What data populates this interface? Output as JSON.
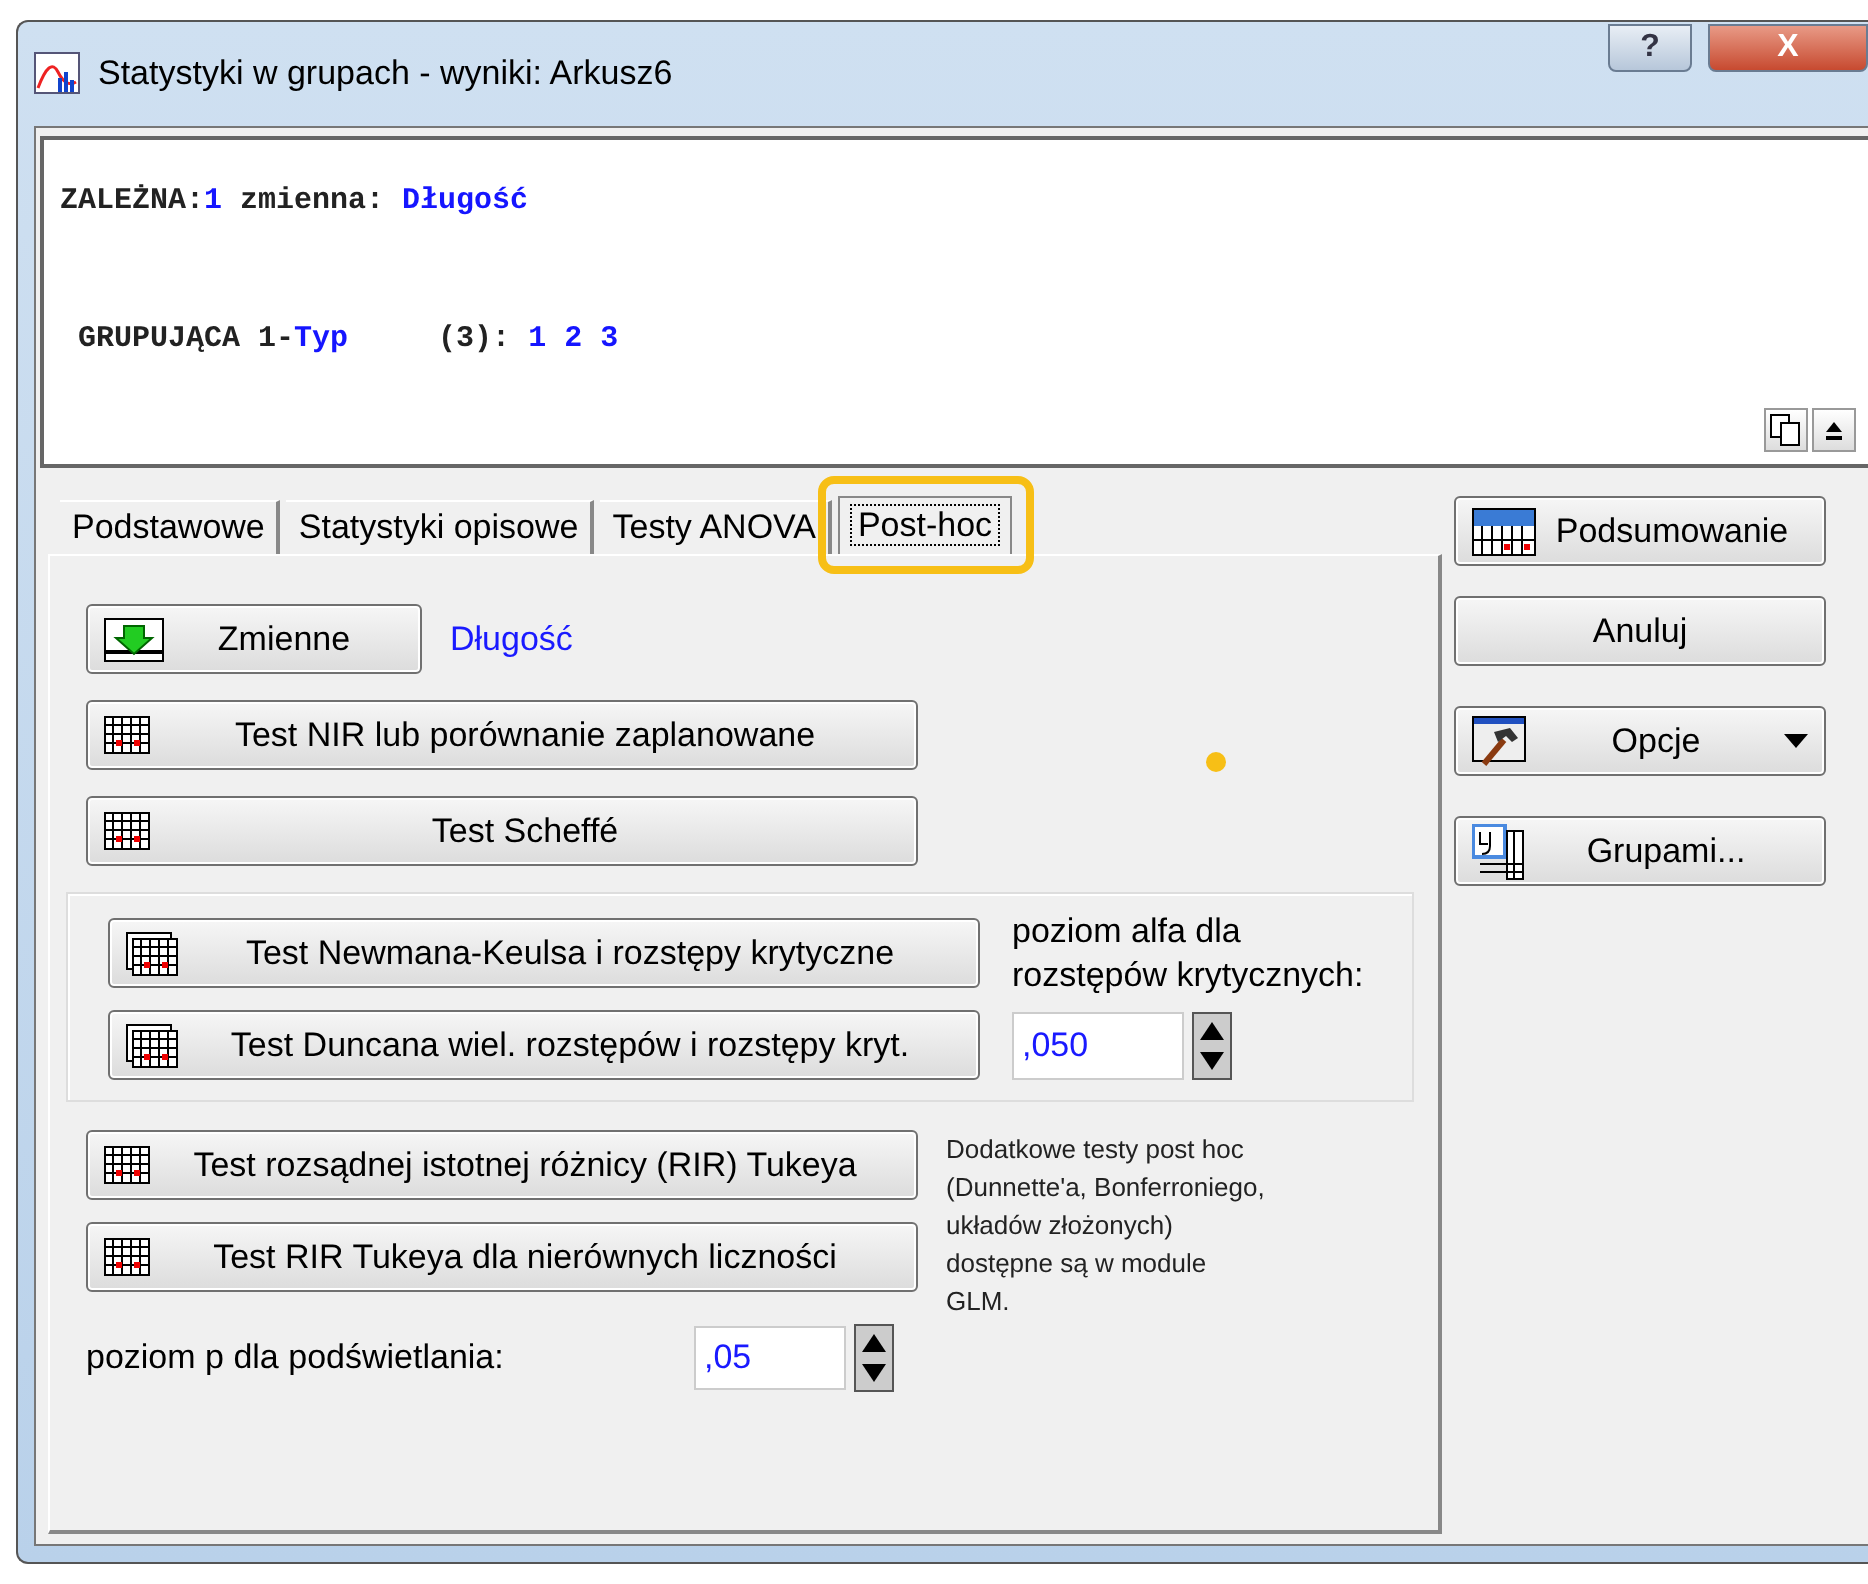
{
  "window": {
    "title": "Statystyki w grupach - wyniki: Arkusz6",
    "buttons": [
      {
        "kind": "help",
        "label": "?"
      },
      {
        "kind": "close",
        "label": "X"
      }
    ]
  },
  "output": {
    "lines": [
      [
        {
          "kind": "label",
          "text": "ZALEŻNA:"
        },
        {
          "kind": "value",
          "text": "1"
        },
        {
          "kind": "label",
          "text": " zmienna: "
        },
        {
          "kind": "value",
          "text": "Długość"
        }
      ],
      [
        {
          "kind": "label",
          "text": " GRUPUJĄCA 1-"
        },
        {
          "kind": "value",
          "text": "Typ"
        },
        {
          "kind": "label",
          "text": "     (3): "
        },
        {
          "kind": "value",
          "text": "1 2 3"
        }
      ]
    ]
  },
  "tabs": [
    {
      "label": "Podstawowe",
      "selected": false,
      "highlighted": false
    },
    {
      "label": "Statystyki opisowe",
      "selected": false,
      "highlighted": false
    },
    {
      "label": "Testy ANOVA",
      "selected": false,
      "highlighted": false
    },
    {
      "label": "Post-hoc",
      "selected": true,
      "highlighted": true
    }
  ],
  "post_hoc": {
    "variables_button": {
      "label": "Zmienne",
      "value": "Długość"
    },
    "buttons": [
      {
        "label": "Test NIR lub porównanie zaplanowane"
      },
      {
        "label": "Test Scheffé"
      }
    ],
    "range_group": {
      "buttons": [
        {
          "label": "Test Newmana-Keulsa i rozstępy krytyczne"
        },
        {
          "label": "Test Duncana wiel. rozstępów i rozstępy kryt."
        }
      ],
      "alpha_label": "poziom alfa dla rozstępów krytycznych:",
      "alpha_value": ",050"
    },
    "tukey_buttons": [
      {
        "label": "Test rozsądnej istotnej różnicy (RIR) Tukeya"
      },
      {
        "label": "Test RIR Tukeya dla nierównych liczności"
      }
    ],
    "note": "Dodatkowe testy post hoc (Dunnette'a, Bonferroniego, układów złożonych) dostępne są w module GLM.",
    "p_label": "poziom p dla podświetlania:",
    "p_value": ",05"
  },
  "side_buttons": [
    {
      "kind": "summary",
      "label": "Podsumowanie"
    },
    {
      "kind": "plain",
      "label": "Anuluj"
    },
    {
      "kind": "options",
      "label": "Opcje"
    },
    {
      "kind": "groups",
      "label": "Grupami..."
    }
  ],
  "pointer_dot": true
}
